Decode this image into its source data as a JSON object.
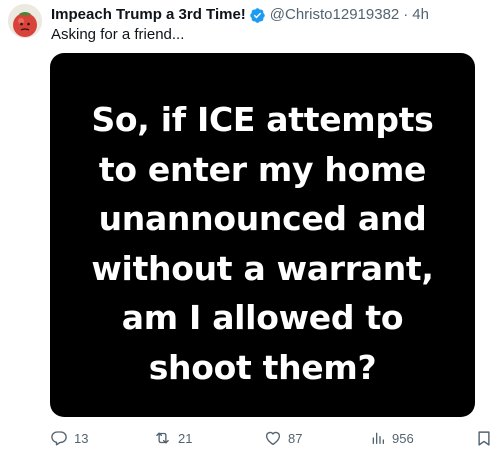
{
  "tweet": {
    "author": {
      "display_name": "Impeach Trump a 3rd Time!",
      "handle": "@Christo12919382",
      "separator": "·",
      "time": "4h",
      "verified_color": "#1d9bf0"
    },
    "text": "Asking for a friend...",
    "media": {
      "lines": [
        "So, if ICE attempts",
        "to enter my home",
        "unannounced and",
        "without a warrant,",
        "am I allowed to",
        "shoot them?"
      ]
    },
    "actions": {
      "replies": "13",
      "reposts": "21",
      "likes": "87",
      "views": "956"
    },
    "icons": {
      "avatar": "tomato-avatar-icon",
      "verified": "verified-badge-icon",
      "reply": "reply-icon",
      "repost": "repost-icon",
      "like": "heart-icon",
      "views": "views-chart-icon",
      "bookmark": "bookmark-icon"
    }
  }
}
